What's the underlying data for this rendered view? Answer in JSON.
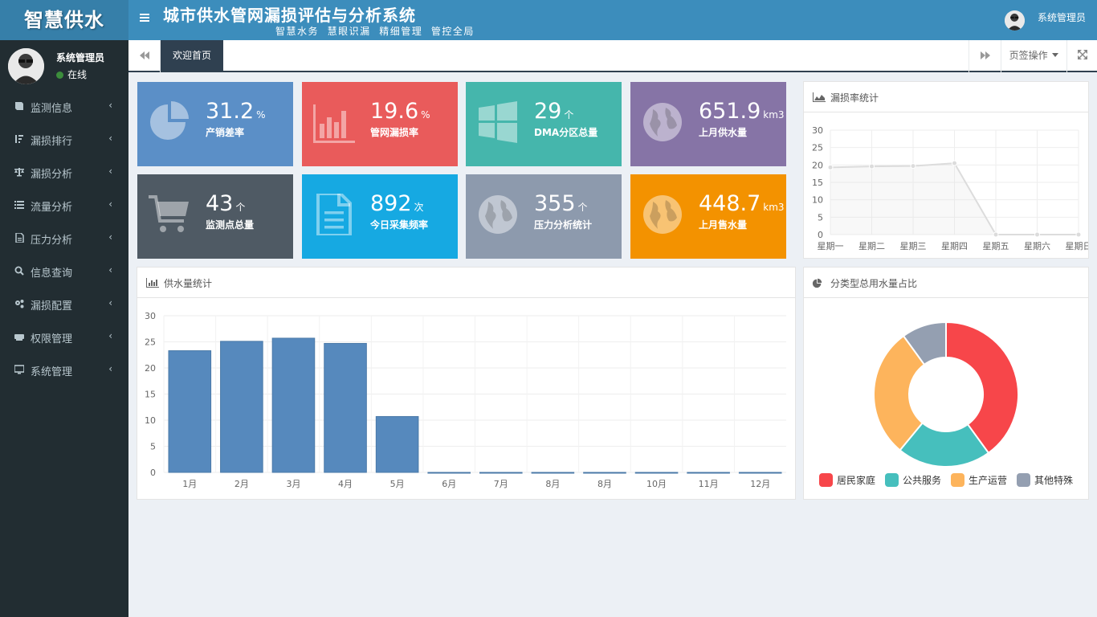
{
  "brand": {
    "logo": "智慧供水"
  },
  "user": {
    "name": "系统管理员",
    "status": "在线"
  },
  "menu": [
    {
      "label": "监测信息",
      "icon": "book-icon"
    },
    {
      "label": "漏损排行",
      "icon": "sort-icon"
    },
    {
      "label": "漏损分析",
      "icon": "balance-icon"
    },
    {
      "label": "流量分析",
      "icon": "list-icon"
    },
    {
      "label": "压力分析",
      "icon": "file-icon"
    },
    {
      "label": "信息查询",
      "icon": "search-icon"
    },
    {
      "label": "漏损配置",
      "icon": "gears-icon"
    },
    {
      "label": "权限管理",
      "icon": "keyboard-icon"
    },
    {
      "label": "系统管理",
      "icon": "desktop-icon"
    }
  ],
  "header": {
    "title": "城市供水管网漏损评估与分析系统",
    "subtitle": "智慧水务  慧眼识漏  精细管理  管控全局",
    "user": "系统管理员"
  },
  "tabs": {
    "active": "欢迎首页",
    "ops": "页签操作"
  },
  "tiles": [
    {
      "value": "31.2",
      "unit": "%",
      "label": "产销差率",
      "color": "#5b8fc7",
      "icon": "pie-chart-icon"
    },
    {
      "value": "19.6",
      "unit": "%",
      "label": "管网漏损率",
      "color": "#e95b5b",
      "icon": "bar-chart-icon"
    },
    {
      "value": "29",
      "unit": "个",
      "label": "DMA分区总量",
      "color": "#45b6ac",
      "icon": "windows-icon"
    },
    {
      "value": "651.9",
      "unit": "km3",
      "label": "上月供水量",
      "color": "#8674a6",
      "icon": "globe-icon"
    },
    {
      "value": "43",
      "unit": "个",
      "label": "监测点总量",
      "color": "#4f5a64",
      "icon": "cart-icon"
    },
    {
      "value": "892",
      "unit": "次",
      "label": "今日采集频率",
      "color": "#16a9e2",
      "icon": "document-icon"
    },
    {
      "value": "355",
      "unit": "个",
      "label": "压力分析统计",
      "color": "#8d9aad",
      "icon": "globe-icon"
    },
    {
      "value": "448.7",
      "unit": "km3",
      "label": "上月售水量",
      "color": "#f39200",
      "icon": "globe-icon"
    }
  ],
  "panels": {
    "leak": "漏损率统计",
    "supply": "供水量统计",
    "usage": "分类型总用水量占比"
  },
  "chart_data": [
    {
      "type": "line",
      "title": "漏损率统计",
      "categories": [
        "星期一",
        "星期二",
        "星期三",
        "星期四",
        "星期五",
        "星期六",
        "星期日"
      ],
      "values": [
        19.3,
        19.6,
        19.7,
        20.5,
        0,
        0,
        0
      ],
      "ylim": [
        0,
        30
      ],
      "yticks": [
        0,
        5,
        10,
        15,
        20,
        25,
        30
      ],
      "grid": true,
      "color": "#dcdcdc"
    },
    {
      "type": "bar",
      "title": "供水量统计",
      "categories": [
        "1月",
        "2月",
        "3月",
        "4月",
        "5月",
        "6月",
        "7月",
        "8月",
        "8月",
        "10月",
        "11月",
        "12月"
      ],
      "values": [
        23.3,
        25.1,
        25.7,
        24.7,
        10.7,
        0,
        0,
        0,
        0,
        0,
        0,
        0
      ],
      "ylim": [
        0,
        30
      ],
      "yticks": [
        0,
        5,
        10,
        15,
        20,
        25,
        30
      ],
      "grid": true,
      "color": "#5689bd"
    },
    {
      "type": "pie",
      "title": "分类型总用水量占比",
      "donut": true,
      "legend": "bottom",
      "slices": [
        {
          "name": "居民家庭",
          "value": 40,
          "color": "#f7464a"
        },
        {
          "name": "公共服务",
          "value": 21,
          "color": "#46bfbd"
        },
        {
          "name": "生产运营",
          "value": 29,
          "color": "#fdb45c"
        },
        {
          "name": "其他特殊",
          "value": 10,
          "color": "#949fb1"
        }
      ]
    }
  ]
}
